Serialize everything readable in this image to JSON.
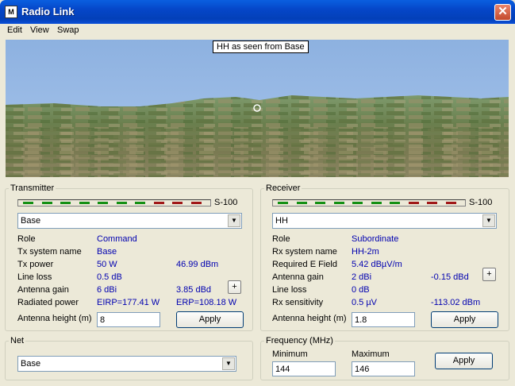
{
  "window": {
    "title": "Radio Link",
    "close_glyph": "✕",
    "app_icon_glyph": "M"
  },
  "menu": [
    "Edit",
    "View",
    "Swap"
  ],
  "scene": {
    "label": "HH as seen from Base"
  },
  "transmitter": {
    "group_label": "Transmitter",
    "meter_label": "S-100",
    "station": "Base",
    "role_label": "Role",
    "role_value": "Command",
    "sysname_label": "Tx system name",
    "sysname_value": "Base",
    "power_label": "Tx power",
    "power_value": "50 W",
    "power_dbm": "46.99 dBm",
    "lineloss_label": "Line loss",
    "lineloss_value": "0.5 dB",
    "gain_label": "Antenna gain",
    "gain_value": "6 dBi",
    "gain_dbd": "3.85 dBd",
    "radiated_label": "Radiated power",
    "eirp": "EIRP=177.41 W",
    "erp": "ERP=108.18 W",
    "height_label": "Antenna height (m)",
    "height_value": "8",
    "apply": "Apply",
    "plus": "+"
  },
  "receiver": {
    "group_label": "Receiver",
    "meter_label": "S-100",
    "station": "HH",
    "role_label": "Role",
    "role_value": "Subordinate",
    "sysname_label": "Rx system name",
    "sysname_value": "HH-2m",
    "field_label": "Required E Field",
    "field_value": "5.42 dBµV/m",
    "gain_label": "Antenna gain",
    "gain_value": "2 dBi",
    "gain_dbd": "-0.15 dBd",
    "lineloss_label": "Line loss",
    "lineloss_value": "0 dB",
    "sens_label": "Rx sensitivity",
    "sens_value": "0.5 µV",
    "sens_dbm": "-113.02 dBm",
    "height_label": "Antenna height (m)",
    "height_value": "1.8",
    "apply": "Apply",
    "plus": "+"
  },
  "net": {
    "group_label": "Net",
    "value": "Base"
  },
  "frequency": {
    "group_label": "Frequency (MHz)",
    "min_label": "Minimum",
    "min_value": "144",
    "max_label": "Maximum",
    "max_value": "146",
    "apply": "Apply"
  },
  "colors": {
    "meter_green": "#149014",
    "meter_red": "#a01818",
    "value_blue": "#0000b0"
  }
}
